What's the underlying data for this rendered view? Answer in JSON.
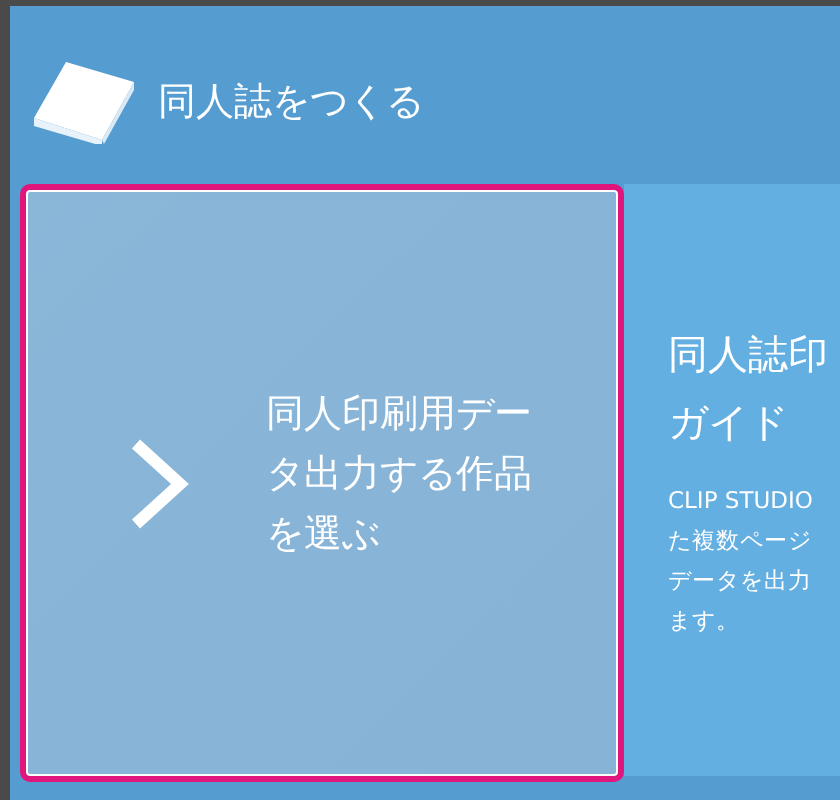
{
  "header": {
    "title": "同人誌をつくる"
  },
  "options": [
    {
      "label": "同人印刷用データ出力する作品を選ぶ",
      "selected": true
    }
  ],
  "guide": {
    "title_lines": [
      "同人誌印",
      "ガイド"
    ],
    "description_lines": [
      "CLIP STUDIO",
      "た複数ページ",
      "データを出力",
      "ます。"
    ]
  }
}
